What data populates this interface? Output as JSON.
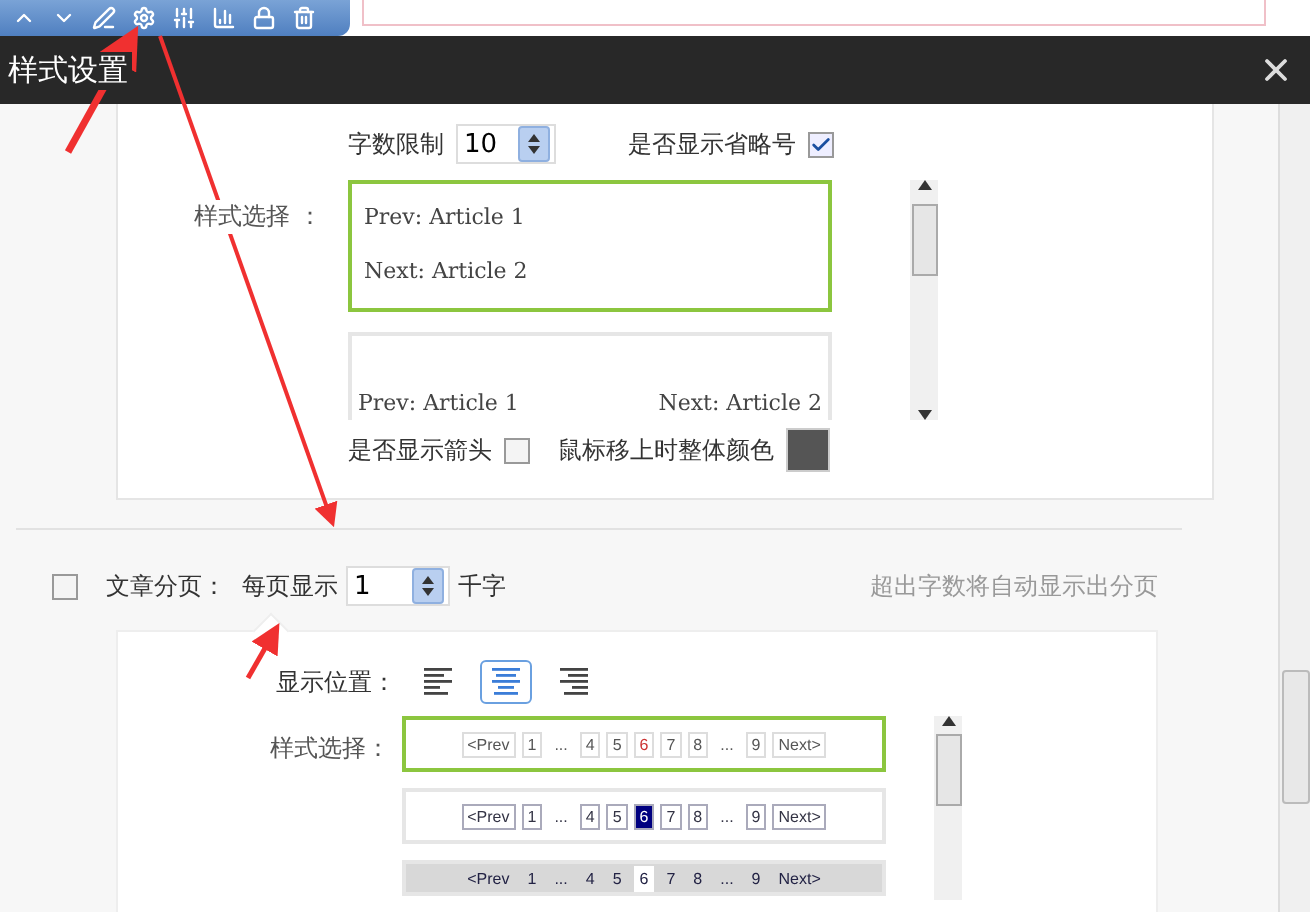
{
  "dialog": {
    "title": "样式设置"
  },
  "article_nav": {
    "char_limit": {
      "label": "字数限制",
      "value": "10"
    },
    "ellipsis": {
      "label": "是否显示省略号",
      "checked": true
    },
    "style_label": "样式选择 ：",
    "styles": [
      {
        "kind": "stacked",
        "selected": true,
        "prev": "Prev: Article 1",
        "next": "Next: Article 2"
      },
      {
        "kind": "inline",
        "selected": false,
        "prev": "Prev: Article 1",
        "next": "Next: Article 2"
      }
    ],
    "arrow": {
      "label": "是否显示箭头",
      "checked": false
    },
    "hover_color": {
      "label": "鼠标移上时整体颜色",
      "color": "#555555"
    }
  },
  "pagination": {
    "label": "文章分页：",
    "checked": false,
    "per_page_label": "每页显示",
    "per_page": "1",
    "unit": "千字",
    "hint": "超出字数将自动显示出分页",
    "position_label": "显示位置：",
    "alignments": [
      {
        "kind": "left",
        "selected": false
      },
      {
        "kind": "center",
        "selected": true
      },
      {
        "kind": "right",
        "selected": false
      }
    ],
    "style_label": "样式选择：",
    "styles": [
      {
        "kind": "plain",
        "selected": true,
        "pages": [
          {
            "label": "<Prev",
            "current": false
          },
          {
            "label": "1",
            "current": false
          },
          {
            "label": "...",
            "current": false
          },
          {
            "label": "4",
            "current": false
          },
          {
            "label": "5",
            "current": false
          },
          {
            "label": "6",
            "current": true
          },
          {
            "label": "7",
            "current": false
          },
          {
            "label": "8",
            "current": false
          },
          {
            "label": "...",
            "current": false
          },
          {
            "label": "9",
            "current": false
          },
          {
            "label": "Next>",
            "current": false
          }
        ]
      },
      {
        "kind": "boxed",
        "selected": false,
        "pages": [
          {
            "label": "<Prev",
            "current": false
          },
          {
            "label": "1",
            "current": false
          },
          {
            "label": "...",
            "current": false
          },
          {
            "label": "4",
            "current": false
          },
          {
            "label": "5",
            "current": false
          },
          {
            "label": "6",
            "current": true
          },
          {
            "label": "7",
            "current": false
          },
          {
            "label": "8",
            "current": false
          },
          {
            "label": "...",
            "current": false
          },
          {
            "label": "9",
            "current": false
          },
          {
            "label": "Next>",
            "current": false
          }
        ]
      },
      {
        "kind": "bar",
        "selected": false,
        "pages": [
          {
            "label": "<Prev",
            "current": false
          },
          {
            "label": "1",
            "current": false
          },
          {
            "label": "...",
            "current": false
          },
          {
            "label": "4",
            "current": false
          },
          {
            "label": "5",
            "current": false
          },
          {
            "label": "6",
            "current": true
          },
          {
            "label": "7",
            "current": false
          },
          {
            "label": "8",
            "current": false
          },
          {
            "label": "...",
            "current": false
          },
          {
            "label": "9",
            "current": false
          },
          {
            "label": "Next>",
            "current": false
          }
        ]
      }
    ]
  }
}
